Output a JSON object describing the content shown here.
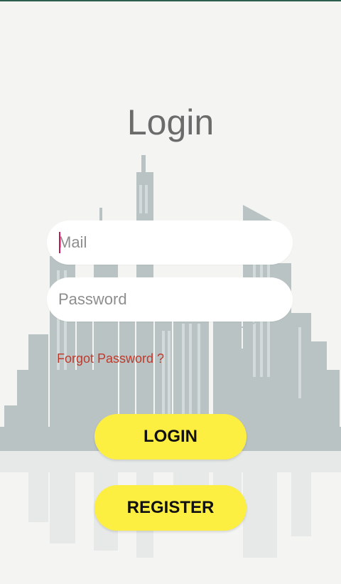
{
  "screen": {
    "title": "Login"
  },
  "form": {
    "mail_placeholder": "Mail",
    "password_placeholder": "Password",
    "forgot_password": "Forgot Password ?"
  },
  "buttons": {
    "login_label": "LOGIN",
    "register_label": "REGISTER"
  },
  "colors": {
    "background": "#f4f4f2",
    "button": "#fdee42",
    "link": "#c0392b",
    "title": "#6b6b6b",
    "skyline": "#b9c2c2"
  },
  "illustration": {
    "name": "city-skyline-background"
  }
}
